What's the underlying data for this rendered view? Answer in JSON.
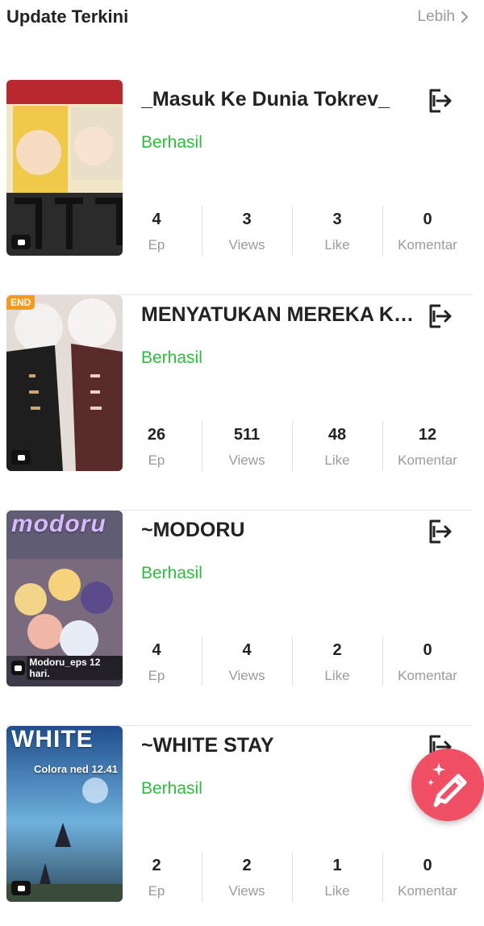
{
  "header": {
    "title": "Update Terkini",
    "more_label": "Lebih"
  },
  "stat_labels": {
    "ep": "Ep",
    "views": "Views",
    "like": "Like",
    "comments": "Komentar"
  },
  "stories": [
    {
      "title": "_Masuk Ke Dunia Tokrev_",
      "status": "Berhasil",
      "ep": "4",
      "views": "3",
      "like": "3",
      "comments": "0"
    },
    {
      "title": "MENYATUKAN MEREKA KE...",
      "status": "Berhasil",
      "ep": "26",
      "views": "511",
      "like": "48",
      "comments": "12",
      "cover_badge": "END"
    },
    {
      "title": "~MODORU",
      "status": "Berhasil",
      "ep": "4",
      "views": "4",
      "like": "2",
      "comments": "0",
      "cover_caption": "Modoru_eps 12 hari.",
      "cover_title": "modoru"
    },
    {
      "title": "~WHITE STAY",
      "status": "Berhasil",
      "ep": "2",
      "views": "2",
      "like": "1",
      "comments": "0",
      "cover_title": "WHITE",
      "cover_subtitle": "Colora ned 12.41"
    }
  ],
  "colors": {
    "status_green": "#2dbd3c",
    "fab": "#f14f63",
    "muted": "#9b9b9b"
  },
  "icons": {
    "share": "share-exit-icon",
    "chevron": "chevron-right-icon",
    "comment": "comment-bubble-icon",
    "edit": "pencil-sparkle-icon"
  }
}
